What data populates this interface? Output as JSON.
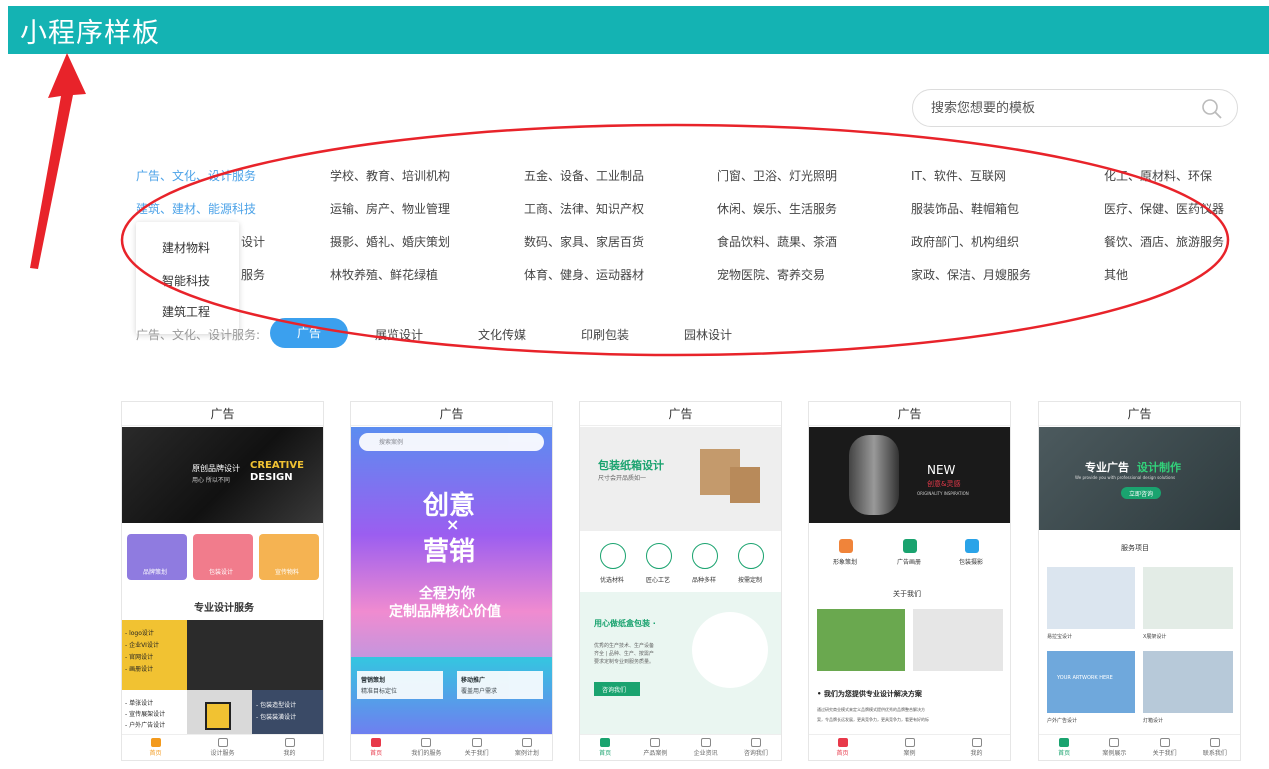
{
  "header": {
    "title": "小程序样板"
  },
  "search": {
    "placeholder": "搜索您想要的模板"
  },
  "categories": [
    [
      "广告、文化、设计服务",
      "学校、教育、培训机构",
      "五金、设备、工业制品",
      "门窗、卫浴、灯光照明",
      "IT、软件、互联网",
      "化工、原材料、环保"
    ],
    [
      "建筑、建材、能源科技",
      "运输、房产、物业管理",
      "工商、法律、知识产权",
      "休闲、娱乐、生活服务",
      "服装饰品、鞋帽箱包",
      "医疗、保健、医药仪器"
    ],
    [
      "设计",
      "摄影、婚礼、婚庆策划",
      "数码、家具、家居百货",
      "食品饮料、蔬果、茶酒",
      "政府部门、机构组织",
      "餐饮、酒店、旅游服务"
    ],
    [
      "服务",
      "林牧养殖、鲜花绿植",
      "体育、健身、运动器材",
      "宠物医院、寄养交易",
      "家政、保洁、月嫂服务",
      "其他"
    ]
  ],
  "dropdown": [
    "建材物料",
    "智能科技",
    "建筑工程"
  ],
  "subtabs": {
    "label": "广告、文化、设计服务:",
    "items": [
      "广告",
      "展览设计",
      "文化传媒",
      "印刷包装",
      "园林设计"
    ]
  },
  "cards": [
    {
      "title": "广告",
      "banner": {
        "cn": "原创品牌设计",
        "cn2": "用心 所以不同",
        "en1": "CREATIVE",
        "en2": "DESIGN"
      },
      "icons": [
        "品牌策划",
        "包装设计",
        "宣传物料"
      ],
      "section": "专业设计服务",
      "list1": [
        "- logo设计",
        "- 企业VI设计",
        "- 官网设计",
        "- 画册设计"
      ],
      "list2": [
        "- 单张设计",
        "- 宣传展架设计",
        "- 户外广告设计"
      ],
      "list3": [
        "- 包装造型设计",
        "- 包装装潢设计"
      ],
      "nav": [
        "首页",
        "设计服务",
        "我的"
      ]
    },
    {
      "title": "广告",
      "search": "搜索案例",
      "big1": "创意",
      "big2": "×",
      "big3": "营销",
      "slogan1": "全程为你",
      "slogan2": "定制品牌核心价值",
      "box1a": "营销策划",
      "box1b": "精准目标定位",
      "box2a": "移动推广",
      "box2b": "覆盖用户需求",
      "nav": [
        "首页",
        "我们的服务",
        "关于我们",
        "案例计划"
      ]
    },
    {
      "title": "广告",
      "banner1": "包装纸箱设计",
      "banner2": "尺寸会开品质如一",
      "icons": [
        "优选材料",
        "匠心工艺",
        "品种多样",
        "按需定制"
      ],
      "promo1": "用心做纸盒包装 ·",
      "promo2": "优秀的生产技术、生产设备",
      "promo3": "齐全 | 品种、生产、按需产",
      "promo4": "要求定制专业到服务质量。",
      "promo_btn": "咨询我们",
      "nav": [
        "首页",
        "产品案例",
        "企业资讯",
        "咨询我们"
      ]
    },
    {
      "title": "广告",
      "banner1": "NEW",
      "banner2": "创意&灵感",
      "banner3": "ORIGINALITY INSPIRATION",
      "icons": [
        "形象策划",
        "广告画册",
        "包装摄影"
      ],
      "section": "关于我们",
      "text1": "• 我们为您提供专业设计解决方案",
      "text2": "通过研究商业模式来定义品牌模式提供优秀的品牌整合解决方",
      "text3": "案，令品牌长远发展，更具竞争力，更具竞争力，看更有好的标",
      "nav": [
        "首页",
        "案例",
        "我的"
      ]
    },
    {
      "title": "广告",
      "banner1": "专业广告",
      "banner1b": "设计制作",
      "banner2": "We provide you with professional design solutions",
      "banner_btn": "立即咨询",
      "section": "服务项目",
      "items": [
        "易拉宝设计",
        "X展架设计",
        "户外广告设计",
        "灯箱设计"
      ],
      "billboard": "YOUR ARTWORK HERE",
      "nav": [
        "首页",
        "案例展示",
        "关于我们",
        "联系我们"
      ]
    }
  ],
  "colors": {
    "header": "#14b3b3",
    "active": "#4da3e8",
    "annotation": "#e8232a"
  }
}
